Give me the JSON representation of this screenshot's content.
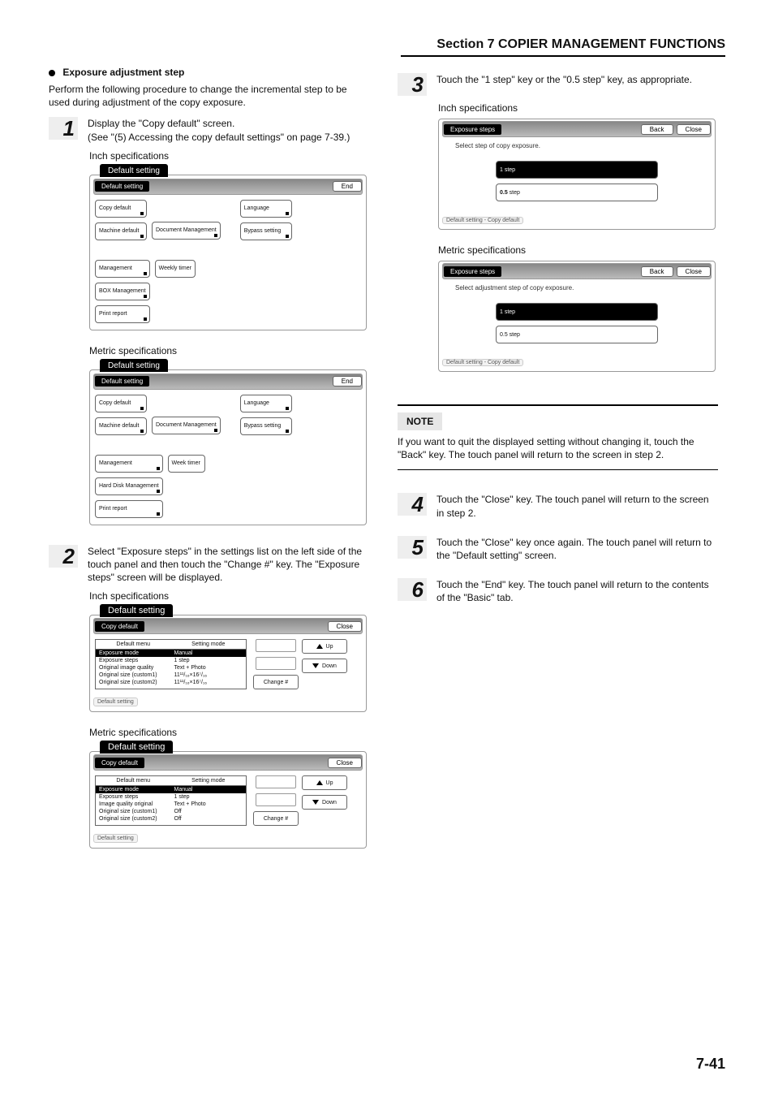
{
  "header": {
    "title": "Section 7  COPIER MANAGEMENT FUNCTIONS"
  },
  "page_number": "7-41",
  "left": {
    "heading": "Exposure adjustment step",
    "intro": "Perform the following procedure to change the incremental step to be used during adjustment of the copy exposure.",
    "step1": {
      "num": "1",
      "line1": "Display the \"Copy default\" screen.",
      "line2": "(See \"(5) Accessing the copy default settings\" on page 7-39.)",
      "inch_label": "Inch specifications",
      "metric_label": "Metric specifications",
      "panel_inch": {
        "tab": "Default setting",
        "bar_label": "Default setting",
        "end_btn": "End",
        "buttons": {
          "copy_default": "Copy default",
          "machine_default": "Machine default",
          "document_mgmt": "Document Management",
          "language": "Language",
          "bypass": "Bypass setting",
          "management": "Management",
          "box_mgmt": "BOX Management",
          "print_report": "Print report",
          "weekly_timer": "Weekly timer"
        }
      },
      "panel_metric": {
        "tab": "Default setting",
        "bar_label": "Default setting",
        "end_btn": "End",
        "buttons": {
          "copy_default": "Copy default",
          "machine_default": "Machine default",
          "document_mgmt": "Document Management",
          "language": "Language",
          "bypass": "Bypass setting",
          "management": "Management",
          "hdd_mgmt": "Hard Disk Management",
          "print_report": "Print report",
          "week_timer": "Week timer"
        }
      }
    },
    "step2": {
      "num": "2",
      "text": "Select \"Exposure steps\" in the settings list on the left side of the touch panel and then touch the \"Change #\" key. The \"Exposure steps\" screen will be displayed.",
      "inch_label": "Inch specifications",
      "metric_label": "Metric specifications",
      "list_inch": {
        "tab": "Default setting",
        "bar_label": "Copy default",
        "close_btn": "Close",
        "th1": "Default menu",
        "th2": "Setting mode",
        "rows": [
          {
            "a": "Exposure mode",
            "b": "Manual",
            "sel": true
          },
          {
            "a": "Exposure steps",
            "b": "1 step"
          },
          {
            "a": "Original image quality",
            "b": "Text + Photo"
          },
          {
            "a": "Original size (custom1)",
            "b": "11¹¹/₁₆×16⁷/₁₆"
          },
          {
            "a": "Original size (custom2)",
            "b": "11¹¹/₁₆×16⁷/₁₆"
          }
        ],
        "up": "Up",
        "down": "Down",
        "change": "Change #",
        "foot": "Default setting"
      },
      "list_metric": {
        "tab": "Default setting",
        "bar_label": "Copy default",
        "close_btn": "Close",
        "th1": "Default menu",
        "th2": "Setting mode",
        "rows": [
          {
            "a": "Exposure mode",
            "b": "Manual",
            "sel": true
          },
          {
            "a": "Exposure steps",
            "b": "1 step"
          },
          {
            "a": "Image quality original",
            "b": "Text + Photo"
          },
          {
            "a": "Original size (custom1)",
            "b": "Off"
          },
          {
            "a": "Original size (custom2)",
            "b": "Off"
          }
        ],
        "up": "Up",
        "down": "Down",
        "change": "Change #",
        "foot": "Default setting"
      }
    }
  },
  "right": {
    "step3": {
      "num": "3",
      "text": "Touch the \"1 step\" key or the \"0.5 step\" key, as appropriate.",
      "inch_label": "Inch specifications",
      "metric_label": "Metric specifications",
      "panel_inch": {
        "bar_label": "Exposure steps",
        "back_btn": "Back",
        "close_btn": "Close",
        "instr": "Select step of copy exposure.",
        "opt1": "1 step",
        "opt2": "0.5 step",
        "foot": "Default setting - Copy default"
      },
      "panel_metric": {
        "bar_label": "Exposure steps",
        "back_btn": "Back",
        "close_btn": "Close",
        "instr": "Select adjustment step of copy exposure.",
        "opt1": "1 step",
        "opt2": "0.5 step",
        "foot": "Default setting - Copy default"
      }
    },
    "note": {
      "label": "NOTE",
      "text": "If you want to quit the displayed setting without changing it, touch the \"Back\" key. The touch panel will return to the screen in step 2."
    },
    "step4": {
      "num": "4",
      "text": "Touch the \"Close\" key. The touch panel will return to the screen in step 2."
    },
    "step5": {
      "num": "5",
      "text": "Touch the \"Close\" key once again. The touch panel will return to the \"Default setting\" screen."
    },
    "step6": {
      "num": "6",
      "text": "Touch the \"End\" key. The touch panel will return to the contents of the \"Basic\" tab."
    }
  }
}
